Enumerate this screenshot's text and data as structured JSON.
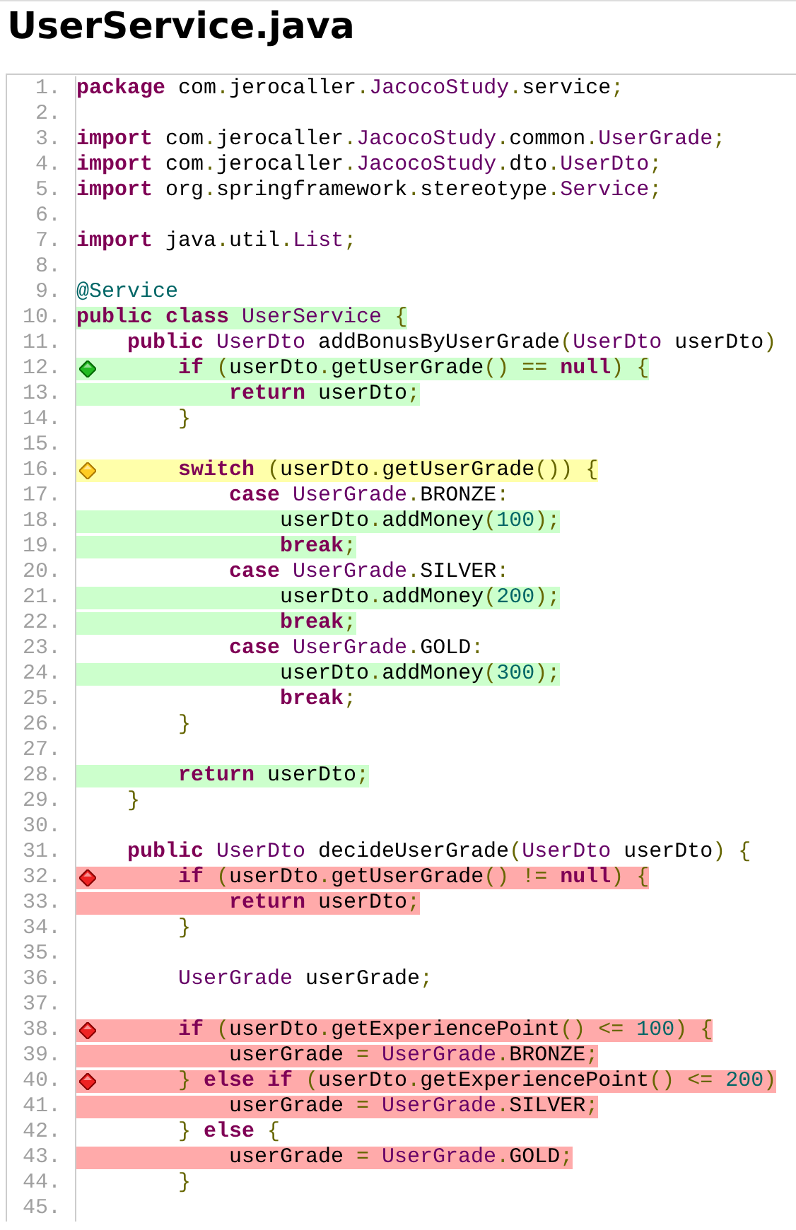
{
  "title": "UserService.java",
  "lines": [
    {
      "number": "1.",
      "kind": "plain",
      "branch": false,
      "code": [
        {
          "kind": "kw",
          "text": "package"
        },
        {
          "kind": "pl",
          "text": " com"
        },
        {
          "kind": "pu",
          "text": "."
        },
        {
          "kind": "pl",
          "text": "jerocaller"
        },
        {
          "kind": "pu",
          "text": "."
        },
        {
          "kind": "ty",
          "text": "JacocoStudy"
        },
        {
          "kind": "pu",
          "text": "."
        },
        {
          "kind": "pl",
          "text": "service"
        },
        {
          "kind": "pu",
          "text": ";"
        }
      ]
    },
    {
      "number": "2.",
      "kind": "plain",
      "branch": false
    },
    {
      "number": "3.",
      "kind": "plain",
      "branch": false,
      "code": [
        {
          "kind": "kw",
          "text": "import"
        },
        {
          "kind": "pl",
          "text": " com"
        },
        {
          "kind": "pu",
          "text": "."
        },
        {
          "kind": "pl",
          "text": "jerocaller"
        },
        {
          "kind": "pu",
          "text": "."
        },
        {
          "kind": "ty",
          "text": "JacocoStudy"
        },
        {
          "kind": "pu",
          "text": "."
        },
        {
          "kind": "pl",
          "text": "common"
        },
        {
          "kind": "pu",
          "text": "."
        },
        {
          "kind": "ty",
          "text": "UserGrade"
        },
        {
          "kind": "pu",
          "text": ";"
        }
      ]
    },
    {
      "number": "4.",
      "kind": "plain",
      "branch": false,
      "code": [
        {
          "kind": "kw",
          "text": "import"
        },
        {
          "kind": "pl",
          "text": " com"
        },
        {
          "kind": "pu",
          "text": "."
        },
        {
          "kind": "pl",
          "text": "jerocaller"
        },
        {
          "kind": "pu",
          "text": "."
        },
        {
          "kind": "ty",
          "text": "JacocoStudy"
        },
        {
          "kind": "pu",
          "text": "."
        },
        {
          "kind": "pl",
          "text": "dto"
        },
        {
          "kind": "pu",
          "text": "."
        },
        {
          "kind": "ty",
          "text": "UserDto"
        },
        {
          "kind": "pu",
          "text": ";"
        }
      ]
    },
    {
      "number": "5.",
      "kind": "plain",
      "branch": false,
      "code": [
        {
          "kind": "kw",
          "text": "import"
        },
        {
          "kind": "pl",
          "text": " org"
        },
        {
          "kind": "pu",
          "text": "."
        },
        {
          "kind": "pl",
          "text": "springframework"
        },
        {
          "kind": "pu",
          "text": "."
        },
        {
          "kind": "pl",
          "text": "stereotype"
        },
        {
          "kind": "pu",
          "text": "."
        },
        {
          "kind": "ty",
          "text": "Service"
        },
        {
          "kind": "pu",
          "text": ";"
        }
      ]
    },
    {
      "number": "6.",
      "kind": "plain",
      "branch": false
    },
    {
      "number": "7.",
      "kind": "plain",
      "branch": false,
      "code": [
        {
          "kind": "kw",
          "text": "import"
        },
        {
          "kind": "pl",
          "text": " java"
        },
        {
          "kind": "pu",
          "text": "."
        },
        {
          "kind": "pl",
          "text": "util"
        },
        {
          "kind": "pu",
          "text": "."
        },
        {
          "kind": "ty",
          "text": "List"
        },
        {
          "kind": "pu",
          "text": ";"
        }
      ]
    },
    {
      "number": "8.",
      "kind": "plain",
      "branch": false
    },
    {
      "number": "9.",
      "kind": "plain",
      "branch": false,
      "code": [
        {
          "kind": "an",
          "text": "@Service"
        }
      ]
    },
    {
      "number": "10.",
      "kind": "covered",
      "branch": false,
      "code": [
        {
          "kind": "kw",
          "text": "public class"
        },
        {
          "kind": "ty",
          "text": " UserService"
        },
        {
          "kind": "pu",
          "text": " {"
        }
      ]
    },
    {
      "number": "11.",
      "kind": "plain",
      "branch": false,
      "code": [
        {
          "kind": "kw",
          "text": "    public"
        },
        {
          "kind": "ty",
          "text": " UserDto"
        },
        {
          "kind": "pl",
          "text": " addBonusByUserGrade"
        },
        {
          "kind": "pu",
          "text": "("
        },
        {
          "kind": "ty",
          "text": "UserDto"
        },
        {
          "kind": "pl",
          "text": " userDto"
        },
        {
          "kind": "pu",
          "text": ")"
        }
      ]
    },
    {
      "number": "12.",
      "kind": "covered",
      "branch": true,
      "code": [
        {
          "kind": "kw",
          "text": "        if"
        },
        {
          "kind": "pu",
          "text": " ("
        },
        {
          "kind": "pl",
          "text": "userDto"
        },
        {
          "kind": "pu",
          "text": "."
        },
        {
          "kind": "pl",
          "text": "getUserGrade"
        },
        {
          "kind": "pu",
          "text": "() =="
        },
        {
          "kind": "kw",
          "text": " null"
        },
        {
          "kind": "pu",
          "text": ") {"
        }
      ]
    },
    {
      "number": "13.",
      "kind": "covered",
      "branch": false,
      "code": [
        {
          "kind": "kw",
          "text": "            return"
        },
        {
          "kind": "pl",
          "text": " userDto"
        },
        {
          "kind": "pu",
          "text": ";"
        }
      ]
    },
    {
      "number": "14.",
      "kind": "plain",
      "branch": false,
      "code": [
        {
          "kind": "pu",
          "text": "        }"
        }
      ]
    },
    {
      "number": "15.",
      "kind": "plain",
      "branch": false
    },
    {
      "number": "16.",
      "kind": "partial",
      "branch": true,
      "code": [
        {
          "kind": "kw",
          "text": "        switch"
        },
        {
          "kind": "pu",
          "text": " ("
        },
        {
          "kind": "pl",
          "text": "userDto"
        },
        {
          "kind": "pu",
          "text": "."
        },
        {
          "kind": "pl",
          "text": "getUserGrade"
        },
        {
          "kind": "pu",
          "text": "()) {"
        }
      ]
    },
    {
      "number": "17.",
      "kind": "plain",
      "branch": false,
      "code": [
        {
          "kind": "kw",
          "text": "            case"
        },
        {
          "kind": "ty",
          "text": " UserGrade"
        },
        {
          "kind": "pu",
          "text": "."
        },
        {
          "kind": "pl",
          "text": "BRONZE"
        },
        {
          "kind": "pu",
          "text": ":"
        }
      ]
    },
    {
      "number": "18.",
      "kind": "covered",
      "branch": false,
      "code": [
        {
          "kind": "pl",
          "text": "                userDto"
        },
        {
          "kind": "pu",
          "text": "."
        },
        {
          "kind": "pl",
          "text": "addMoney"
        },
        {
          "kind": "pu",
          "text": "("
        },
        {
          "kind": "nu",
          "text": "100"
        },
        {
          "kind": "pu",
          "text": ");"
        }
      ]
    },
    {
      "number": "19.",
      "kind": "covered",
      "branch": false,
      "code": [
        {
          "kind": "kw",
          "text": "                break"
        },
        {
          "kind": "pu",
          "text": ";"
        }
      ]
    },
    {
      "number": "20.",
      "kind": "plain",
      "branch": false,
      "code": [
        {
          "kind": "kw",
          "text": "            case"
        },
        {
          "kind": "ty",
          "text": " UserGrade"
        },
        {
          "kind": "pu",
          "text": "."
        },
        {
          "kind": "pl",
          "text": "SILVER"
        },
        {
          "kind": "pu",
          "text": ":"
        }
      ]
    },
    {
      "number": "21.",
      "kind": "covered",
      "branch": false,
      "code": [
        {
          "kind": "pl",
          "text": "                userDto"
        },
        {
          "kind": "pu",
          "text": "."
        },
        {
          "kind": "pl",
          "text": "addMoney"
        },
        {
          "kind": "pu",
          "text": "("
        },
        {
          "kind": "nu",
          "text": "200"
        },
        {
          "kind": "pu",
          "text": ");"
        }
      ]
    },
    {
      "number": "22.",
      "kind": "covered",
      "branch": false,
      "code": [
        {
          "kind": "kw",
          "text": "                break"
        },
        {
          "kind": "pu",
          "text": ";"
        }
      ]
    },
    {
      "number": "23.",
      "kind": "plain",
      "branch": false,
      "code": [
        {
          "kind": "kw",
          "text": "            case"
        },
        {
          "kind": "ty",
          "text": " UserGrade"
        },
        {
          "kind": "pu",
          "text": "."
        },
        {
          "kind": "pl",
          "text": "GOLD"
        },
        {
          "kind": "pu",
          "text": ":"
        }
      ]
    },
    {
      "number": "24.",
      "kind": "covered",
      "branch": false,
      "code": [
        {
          "kind": "pl",
          "text": "                userDto"
        },
        {
          "kind": "pu",
          "text": "."
        },
        {
          "kind": "pl",
          "text": "addMoney"
        },
        {
          "kind": "pu",
          "text": "("
        },
        {
          "kind": "nu",
          "text": "300"
        },
        {
          "kind": "pu",
          "text": ");"
        }
      ]
    },
    {
      "number": "25.",
      "kind": "plain",
      "branch": false,
      "code": [
        {
          "kind": "kw",
          "text": "                break"
        },
        {
          "kind": "pu",
          "text": ";"
        }
      ]
    },
    {
      "number": "26.",
      "kind": "plain",
      "branch": false,
      "code": [
        {
          "kind": "pu",
          "text": "        }"
        }
      ]
    },
    {
      "number": "27.",
      "kind": "plain",
      "branch": false
    },
    {
      "number": "28.",
      "kind": "covered",
      "branch": false,
      "code": [
        {
          "kind": "kw",
          "text": "        return"
        },
        {
          "kind": "pl",
          "text": " userDto"
        },
        {
          "kind": "pu",
          "text": ";"
        }
      ]
    },
    {
      "number": "29.",
      "kind": "plain",
      "branch": false,
      "code": [
        {
          "kind": "pu",
          "text": "    }"
        }
      ]
    },
    {
      "number": "30.",
      "kind": "plain",
      "branch": false
    },
    {
      "number": "31.",
      "kind": "plain",
      "branch": false,
      "code": [
        {
          "kind": "kw",
          "text": "    public"
        },
        {
          "kind": "ty",
          "text": " UserDto"
        },
        {
          "kind": "pl",
          "text": " decideUserGrade"
        },
        {
          "kind": "pu",
          "text": "("
        },
        {
          "kind": "ty",
          "text": "UserDto"
        },
        {
          "kind": "pl",
          "text": " userDto"
        },
        {
          "kind": "pu",
          "text": ") {"
        }
      ]
    },
    {
      "number": "32.",
      "kind": "missed",
      "branch": true,
      "code": [
        {
          "kind": "kw",
          "text": "        if"
        },
        {
          "kind": "pu",
          "text": " ("
        },
        {
          "kind": "pl",
          "text": "userDto"
        },
        {
          "kind": "pu",
          "text": "."
        },
        {
          "kind": "pl",
          "text": "getUserGrade"
        },
        {
          "kind": "pu",
          "text": "() !="
        },
        {
          "kind": "kw",
          "text": " null"
        },
        {
          "kind": "pu",
          "text": ") {"
        }
      ]
    },
    {
      "number": "33.",
      "kind": "missed",
      "branch": false,
      "code": [
        {
          "kind": "kw",
          "text": "            return"
        },
        {
          "kind": "pl",
          "text": " userDto"
        },
        {
          "kind": "pu",
          "text": ";"
        }
      ]
    },
    {
      "number": "34.",
      "kind": "plain",
      "branch": false,
      "code": [
        {
          "kind": "pu",
          "text": "        }"
        }
      ]
    },
    {
      "number": "35.",
      "kind": "plain",
      "branch": false
    },
    {
      "number": "36.",
      "kind": "plain",
      "branch": false,
      "code": [
        {
          "kind": "ty",
          "text": "        UserGrade"
        },
        {
          "kind": "pl",
          "text": " userGrade"
        },
        {
          "kind": "pu",
          "text": ";"
        }
      ]
    },
    {
      "number": "37.",
      "kind": "plain",
      "branch": false
    },
    {
      "number": "38.",
      "kind": "missed",
      "branch": true,
      "code": [
        {
          "kind": "kw",
          "text": "        if"
        },
        {
          "kind": "pu",
          "text": " ("
        },
        {
          "kind": "pl",
          "text": "userDto"
        },
        {
          "kind": "pu",
          "text": "."
        },
        {
          "kind": "pl",
          "text": "getExperiencePoint"
        },
        {
          "kind": "pu",
          "text": "() <="
        },
        {
          "kind": "nu",
          "text": " 100"
        },
        {
          "kind": "pu",
          "text": ") {"
        }
      ]
    },
    {
      "number": "39.",
      "kind": "missed",
      "branch": false,
      "code": [
        {
          "kind": "pl",
          "text": "            userGrade"
        },
        {
          "kind": "pu",
          "text": " ="
        },
        {
          "kind": "ty",
          "text": " UserGrade"
        },
        {
          "kind": "pu",
          "text": "."
        },
        {
          "kind": "pl",
          "text": "BRONZE"
        },
        {
          "kind": "pu",
          "text": ";"
        }
      ]
    },
    {
      "number": "40.",
      "kind": "missed",
      "branch": true,
      "code": [
        {
          "kind": "pu",
          "text": "        }"
        },
        {
          "kind": "kw",
          "text": " else if"
        },
        {
          "kind": "pu",
          "text": " ("
        },
        {
          "kind": "pl",
          "text": "userDto"
        },
        {
          "kind": "pu",
          "text": "."
        },
        {
          "kind": "pl",
          "text": "getExperiencePoint"
        },
        {
          "kind": "pu",
          "text": "() <="
        },
        {
          "kind": "nu",
          "text": " 200"
        },
        {
          "kind": "pu",
          "text": ")"
        }
      ]
    },
    {
      "number": "41.",
      "kind": "missed",
      "branch": false,
      "code": [
        {
          "kind": "pl",
          "text": "            userGrade"
        },
        {
          "kind": "pu",
          "text": " ="
        },
        {
          "kind": "ty",
          "text": " UserGrade"
        },
        {
          "kind": "pu",
          "text": "."
        },
        {
          "kind": "pl",
          "text": "SILVER"
        },
        {
          "kind": "pu",
          "text": ";"
        }
      ]
    },
    {
      "number": "42.",
      "kind": "plain",
      "branch": false,
      "code": [
        {
          "kind": "pu",
          "text": "        }"
        },
        {
          "kind": "kw",
          "text": " else"
        },
        {
          "kind": "pu",
          "text": " {"
        }
      ]
    },
    {
      "number": "43.",
      "kind": "missed",
      "branch": false,
      "code": [
        {
          "kind": "pl",
          "text": "            userGrade"
        },
        {
          "kind": "pu",
          "text": " ="
        },
        {
          "kind": "ty",
          "text": " UserGrade"
        },
        {
          "kind": "pu",
          "text": "."
        },
        {
          "kind": "pl",
          "text": "GOLD"
        },
        {
          "kind": "pu",
          "text": ";"
        }
      ]
    },
    {
      "number": "44.",
      "kind": "plain",
      "branch": false,
      "code": [
        {
          "kind": "pu",
          "text": "        }"
        }
      ]
    },
    {
      "number": "45.",
      "kind": "plain",
      "branch": false
    }
  ]
}
